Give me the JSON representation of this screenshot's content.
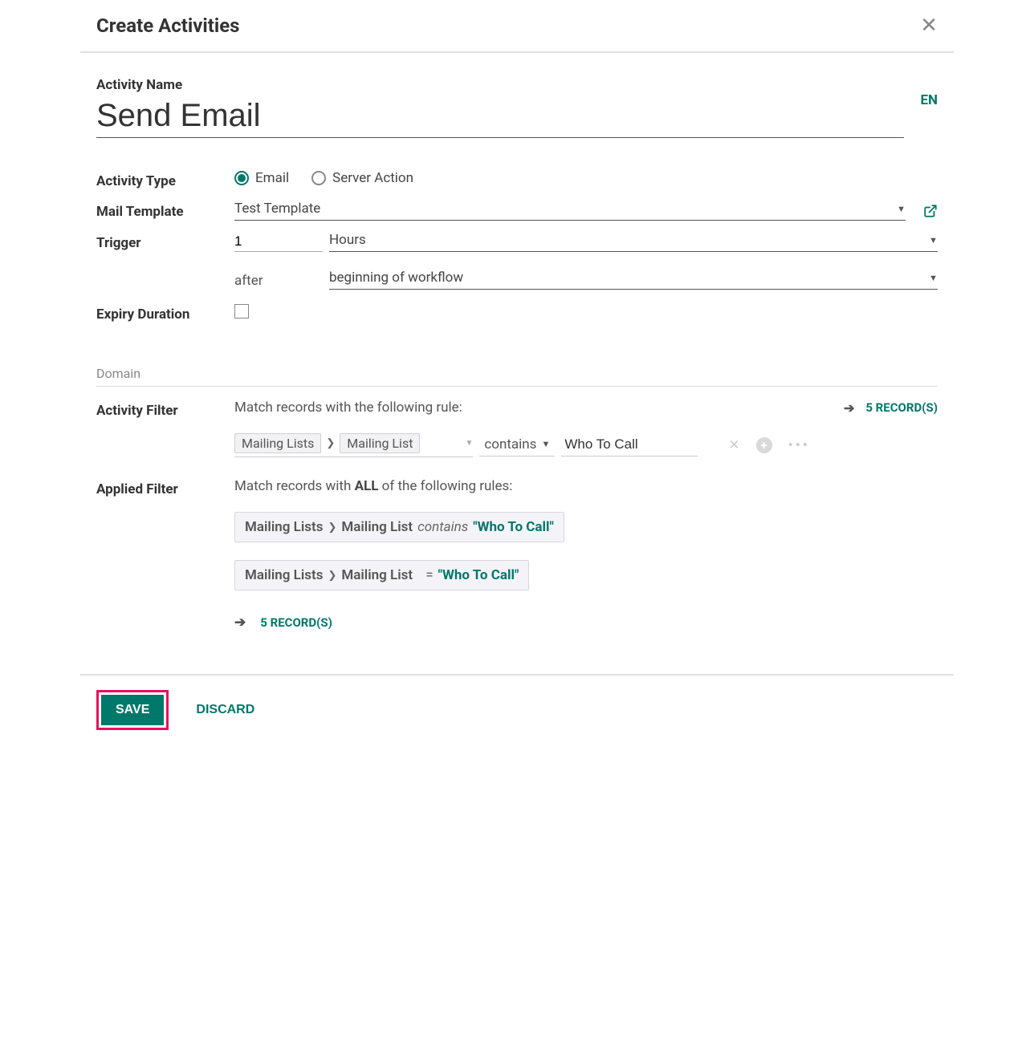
{
  "modal": {
    "title": "Create Activities"
  },
  "activity": {
    "name_label": "Activity Name",
    "name_value": "Send Email",
    "lang": "EN"
  },
  "type": {
    "label": "Activity Type",
    "option_email": "Email",
    "option_server": "Server Action"
  },
  "mail_template": {
    "label": "Mail Template",
    "value": "Test Template"
  },
  "trigger": {
    "label": "Trigger",
    "interval": "1",
    "unit": "Hours",
    "direction": "after",
    "event": "beginning of workflow"
  },
  "expiry": {
    "label": "Expiry Duration"
  },
  "domain": {
    "section_title": "Domain",
    "activity_filter_label": "Activity Filter",
    "activity_filter_desc": "Match records with the following rule:",
    "records_top": "5 RECORD(S)",
    "rule": {
      "field_parent": "Mailing Lists",
      "field_child": "Mailing List",
      "operator": "contains",
      "value": "Who To Call"
    },
    "applied_filter_label": "Applied Filter",
    "applied_desc_prefix": "Match records with ",
    "applied_desc_bold": "ALL",
    "applied_desc_suffix": " of the following rules:",
    "applied_rules": [
      {
        "path1": "Mailing Lists",
        "path2": "Mailing List",
        "op": "contains",
        "op_style": "italic",
        "value": "\"Who To Call\""
      },
      {
        "path1": "Mailing Lists",
        "path2": "Mailing List",
        "op": "=",
        "op_style": "plain",
        "value": "\"Who To Call\""
      }
    ],
    "records_bottom": "5 RECORD(S)"
  },
  "footer": {
    "save": "SAVE",
    "discard": "DISCARD"
  }
}
